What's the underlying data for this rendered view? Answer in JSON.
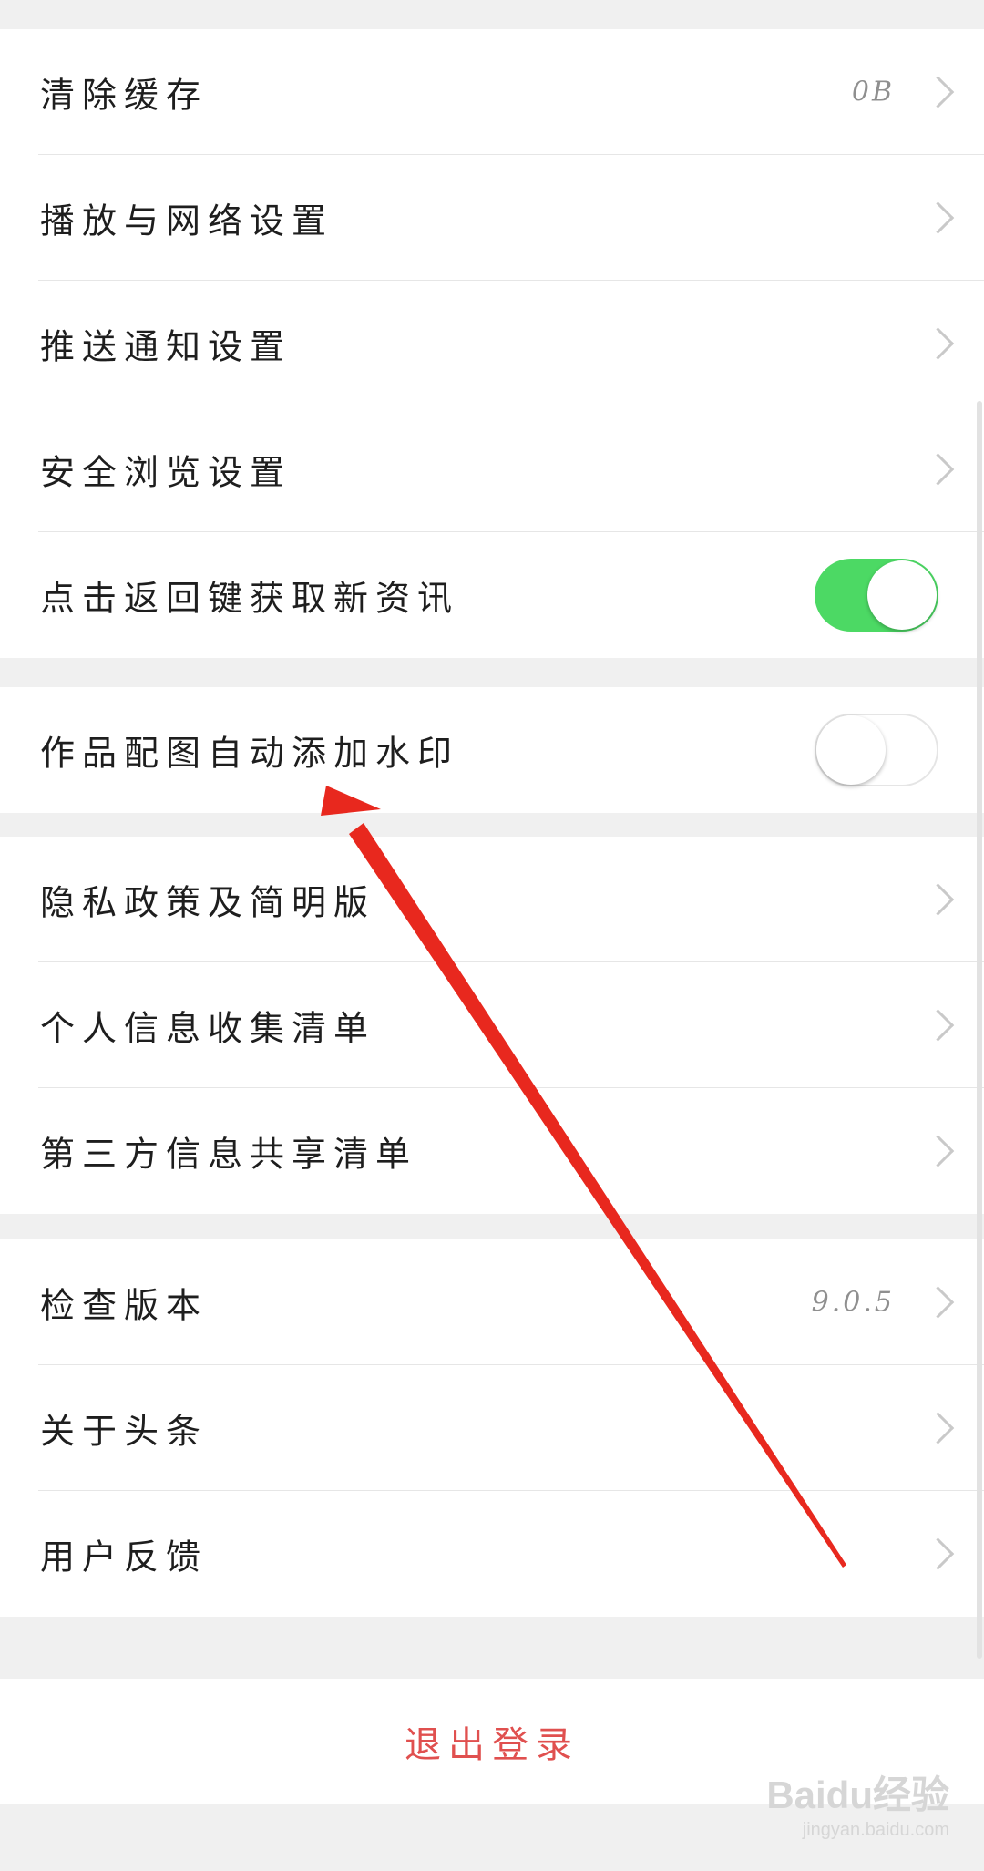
{
  "settings_groups": [
    {
      "rows": [
        {
          "label": "清除缓存",
          "value": "0B",
          "control": "chevron"
        },
        {
          "label": "播放与网络设置",
          "value": "",
          "control": "chevron"
        },
        {
          "label": "推送通知设置",
          "value": "",
          "control": "chevron"
        },
        {
          "label": "安全浏览设置",
          "value": "",
          "control": "chevron"
        },
        {
          "label": "点击返回键获取新资讯",
          "value": "",
          "control": "toggle",
          "toggle_on": true
        }
      ]
    },
    {
      "rows": [
        {
          "label": "作品配图自动添加水印",
          "value": "",
          "control": "toggle",
          "toggle_on": false
        }
      ]
    },
    {
      "rows": [
        {
          "label": "隐私政策及简明版",
          "value": "",
          "control": "chevron"
        },
        {
          "label": "个人信息收集清单",
          "value": "",
          "control": "chevron"
        },
        {
          "label": "第三方信息共享清单",
          "value": "",
          "control": "chevron"
        }
      ]
    },
    {
      "rows": [
        {
          "label": "检查版本",
          "value": "9.0.5",
          "control": "chevron"
        },
        {
          "label": "关于头条",
          "value": "",
          "control": "chevron"
        },
        {
          "label": "用户反馈",
          "value": "",
          "control": "chevron"
        }
      ]
    }
  ],
  "logout_label": "退出登录",
  "watermark": {
    "main": "Baidu经验",
    "sub": "jingyan.baidu.com"
  },
  "colors": {
    "toggle_on": "#4cd964",
    "logout_text": "#e0504f",
    "annotation_arrow": "#e8281e"
  }
}
